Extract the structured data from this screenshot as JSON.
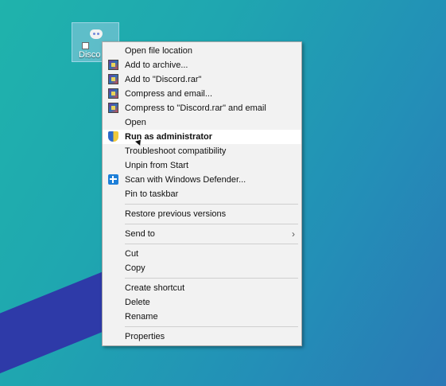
{
  "desktop": {
    "icon_label": "Disco"
  },
  "menu": {
    "items": [
      {
        "label": "Open file location"
      },
      {
        "label": "Add to archive..."
      },
      {
        "label": "Add to \"Discord.rar\""
      },
      {
        "label": "Compress and email..."
      },
      {
        "label": "Compress to \"Discord.rar\" and email"
      },
      {
        "label": "Open"
      },
      {
        "label": "Run as administrator"
      },
      {
        "label": "Troubleshoot compatibility"
      },
      {
        "label": "Unpin from Start"
      },
      {
        "label": "Scan with Windows Defender..."
      },
      {
        "label": "Pin to taskbar"
      },
      {
        "label": "Restore previous versions"
      },
      {
        "label": "Send to"
      },
      {
        "label": "Cut"
      },
      {
        "label": "Copy"
      },
      {
        "label": "Create shortcut"
      },
      {
        "label": "Delete"
      },
      {
        "label": "Rename"
      },
      {
        "label": "Properties"
      }
    ]
  },
  "icons": {
    "rar": "winrar-archive-icon",
    "shield": "uac-shield-icon",
    "defender": "windows-defender-icon",
    "discord": "discord-icon"
  }
}
